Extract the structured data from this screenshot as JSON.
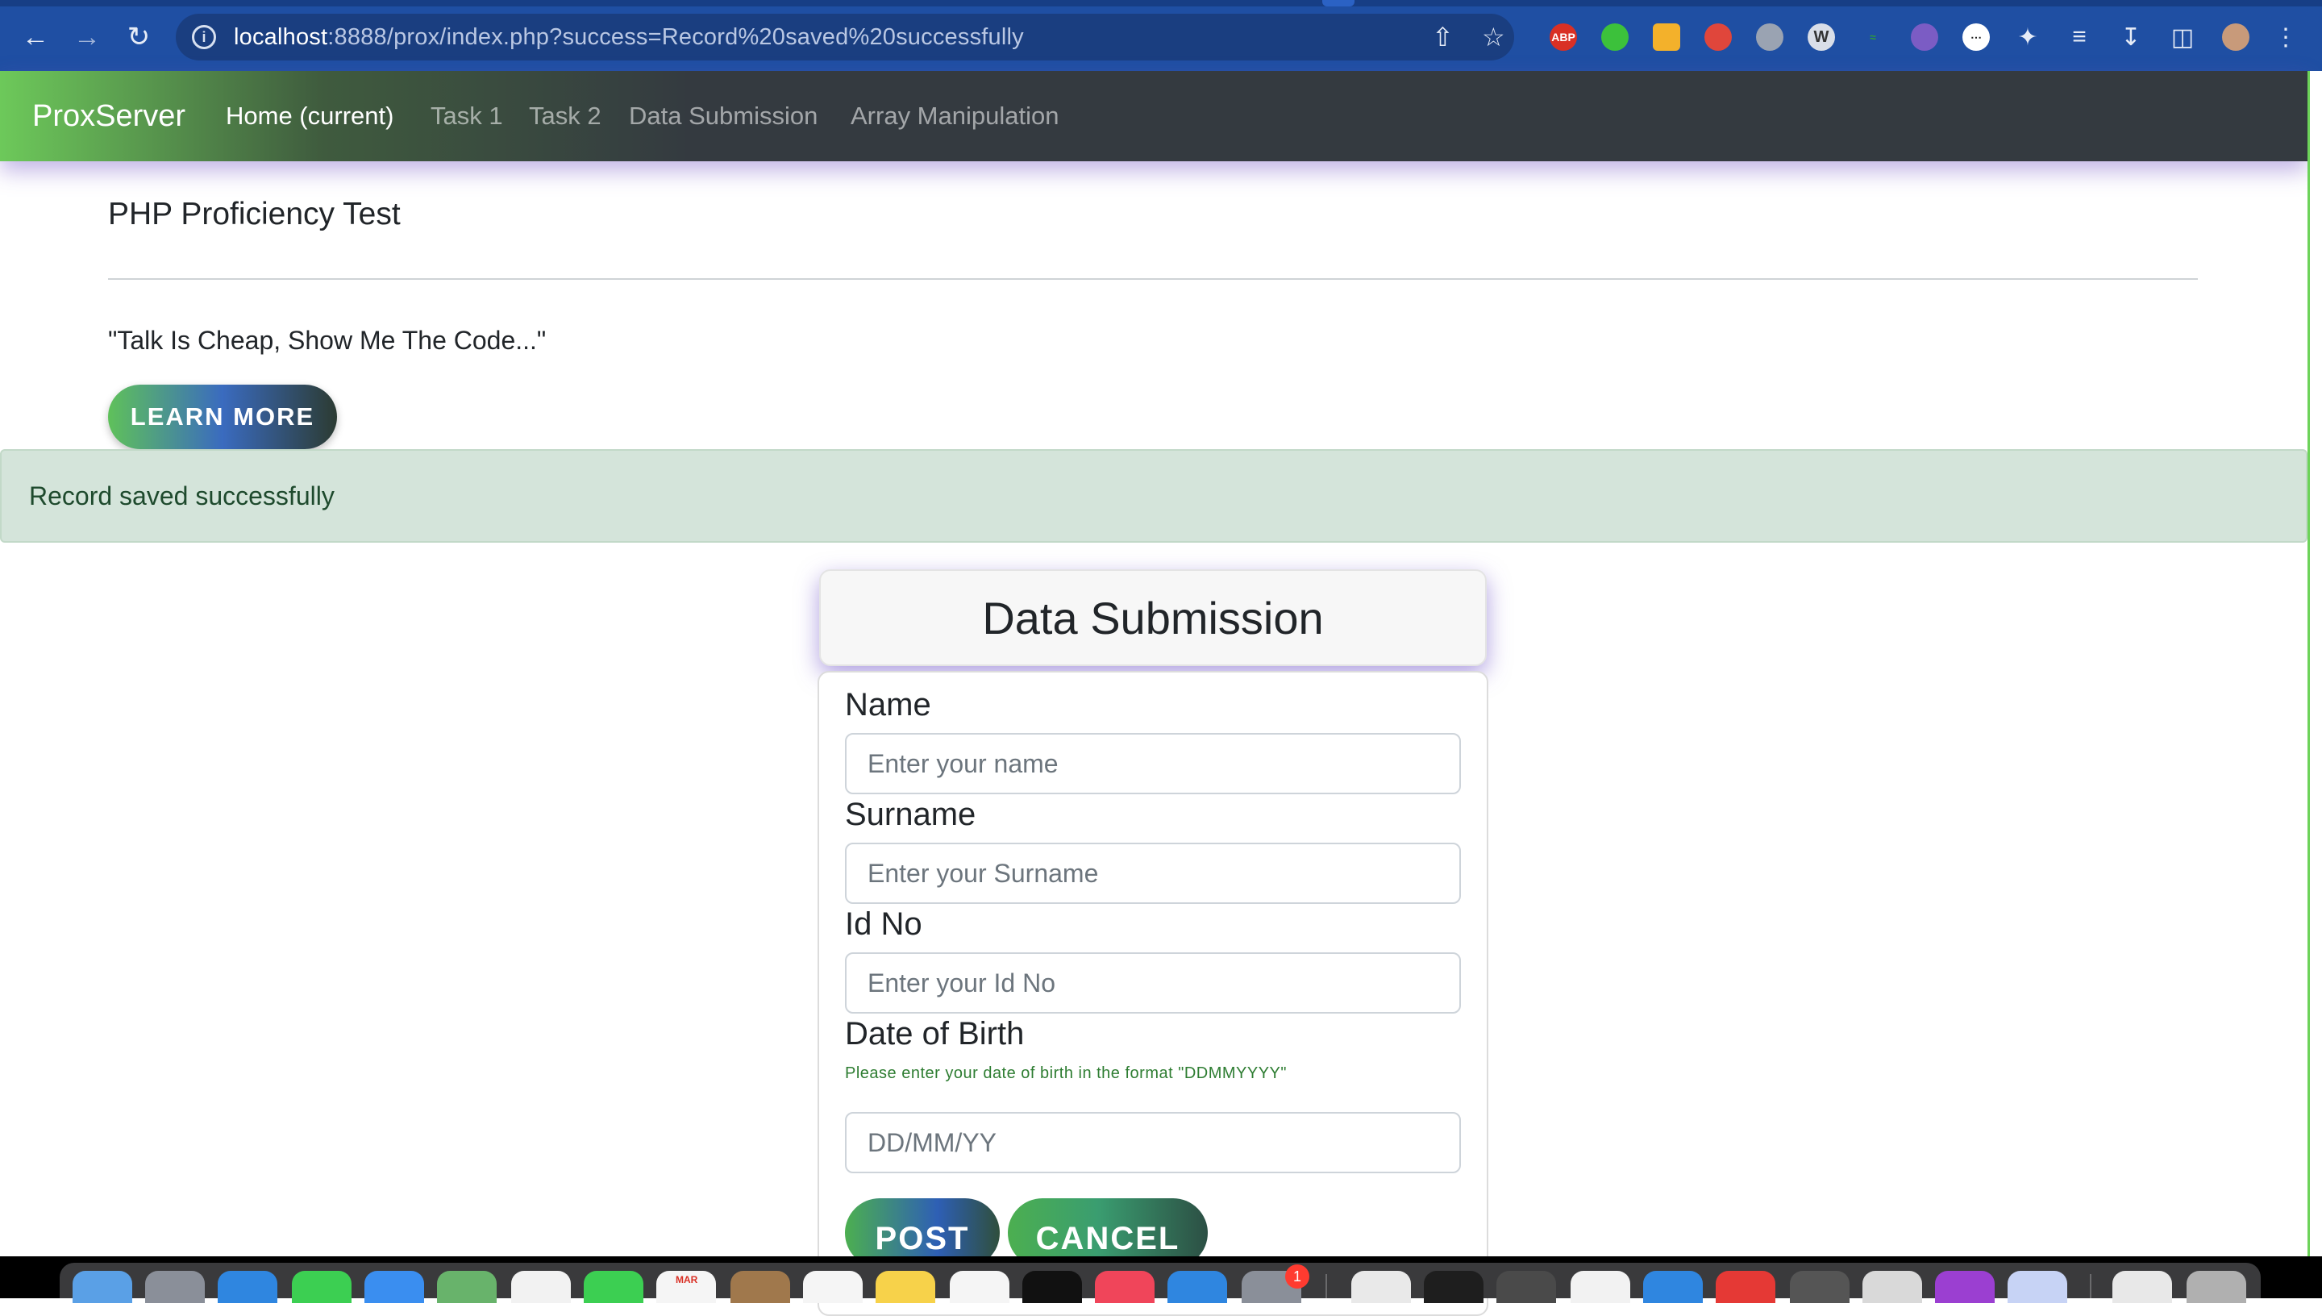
{
  "browser": {
    "url_host": "localhost",
    "url_rest": ":8888/prox/index.php?success=Record%20saved%20successfully",
    "extensions": [
      "abp-icon",
      "green-extension-icon",
      "yellow-extension-icon",
      "red-extension-icon",
      "person-extension-icon",
      "w-extension-icon",
      "bird-extension-icon",
      "fox-extension-icon",
      "dots-extension-icon"
    ],
    "abp_label": "ABP"
  },
  "navbar": {
    "brand": "ProxServer",
    "links": [
      {
        "label": "Home (current)",
        "active": true
      },
      {
        "label": "Task 1",
        "active": false
      },
      {
        "label": "Task 2",
        "active": false
      },
      {
        "label": "Data Submission",
        "active": false
      },
      {
        "label": "Array Manipulation",
        "active": false
      }
    ]
  },
  "jumbotron": {
    "title": "PHP Proficiency Test",
    "quote": "\"Talk Is Cheap, Show Me The Code...\"",
    "button": "LEARN MORE"
  },
  "alert": {
    "message": "Record saved successfully"
  },
  "form": {
    "header": "Data Submission",
    "fields": [
      {
        "label": "Name",
        "placeholder": "Enter your name"
      },
      {
        "label": "Surname",
        "placeholder": "Enter your Surname"
      },
      {
        "label": "Id No",
        "placeholder": "Enter your Id No"
      },
      {
        "label": "Date of Birth",
        "placeholder": "DD/MM/YY",
        "help": "Please enter your date of birth in the format \"DDMMYYYY\""
      }
    ],
    "post_button": "POST",
    "cancel_button": "CANCEL"
  },
  "dock": {
    "calendar_month": "MAR",
    "badge_count": "1",
    "colors": {
      "accent": "#6dc95a",
      "navbar": "#343a40",
      "alert_bg": "#d4e4da"
    }
  }
}
